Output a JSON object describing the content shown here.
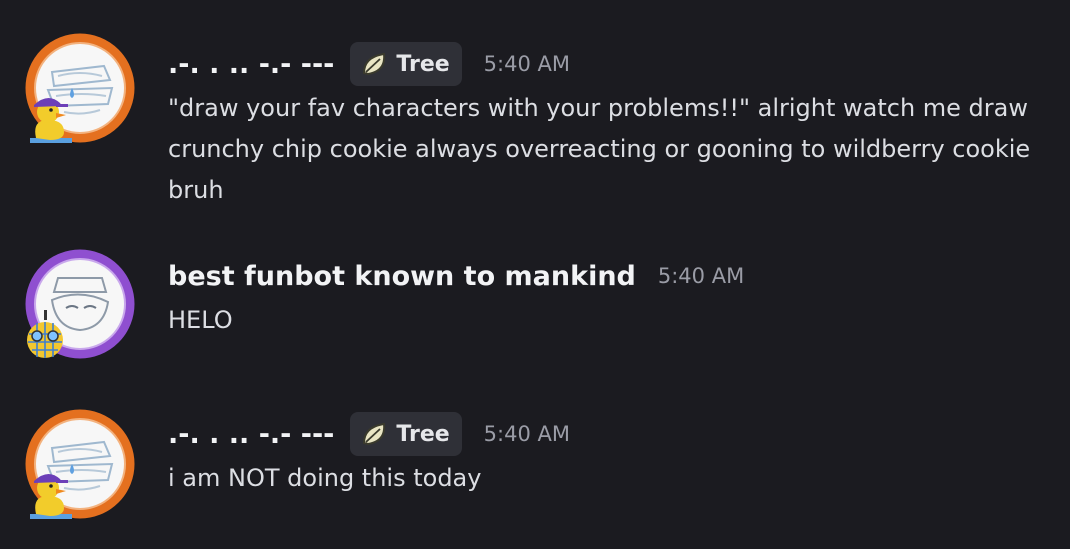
{
  "messages": [
    {
      "username": ".-. . .. -.- ---",
      "tag": {
        "label": "Tree",
        "icon": "leaf-icon"
      },
      "timestamp": "5:40 AM",
      "text": "\"draw your fav characters with your problems!!\" alright watch me draw crunchy chip cookie always overreacting or gooning to wildberry cookie bruh",
      "avatar": {
        "ring_color": "#e4701f",
        "badge": "duck-icon"
      }
    },
    {
      "username": "best funbot known to mankind",
      "timestamp": "5:40 AM",
      "text": "HELO",
      "avatar": {
        "ring_color": "#8f4fd0",
        "badge": "disco-ball-icon"
      }
    },
    {
      "username": ".-. . .. -.- ---",
      "tag": {
        "label": "Tree",
        "icon": "leaf-icon"
      },
      "timestamp": "5:40 AM",
      "text": "i am NOT doing this today",
      "avatar": {
        "ring_color": "#e4701f",
        "badge": "duck-icon"
      }
    }
  ]
}
